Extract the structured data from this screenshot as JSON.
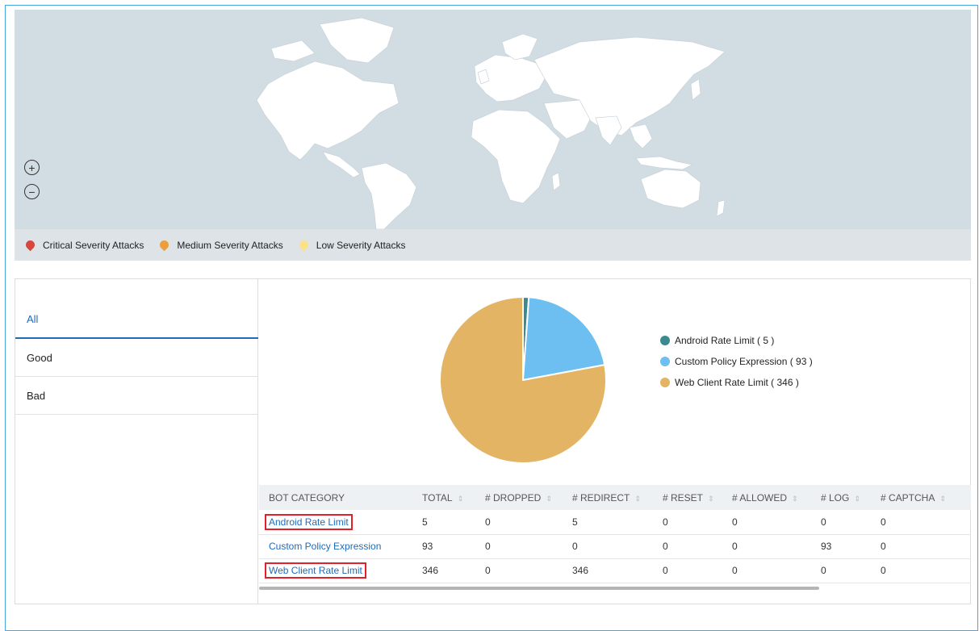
{
  "map": {
    "zoom_in_label": "+",
    "zoom_out_label": "−",
    "legend": [
      {
        "label": "Critical Severity Attacks",
        "color": "#d9463e"
      },
      {
        "label": "Medium Severity Attacks",
        "color": "#ef9d3a"
      },
      {
        "label": "Low Severity Attacks",
        "color": "#fbe28a"
      }
    ]
  },
  "tabs": [
    {
      "label": "All",
      "active": true
    },
    {
      "label": "Good",
      "active": false
    },
    {
      "label": "Bad",
      "active": false
    }
  ],
  "pie": {
    "slices": [
      {
        "label": "Android Rate Limit ( 5 )",
        "value": 5,
        "color": "#3b8a8f"
      },
      {
        "label": "Custom Policy Expression ( 93 )",
        "value": 93,
        "color": "#6cbff0"
      },
      {
        "label": "Web Client Rate Limit ( 346 )",
        "value": 346,
        "color": "#e2b464"
      }
    ]
  },
  "table": {
    "columns": [
      "BOT CATEGORY",
      "TOTAL",
      "# DROPPED",
      "# REDIRECT",
      "# RESET",
      "# ALLOWED",
      "# LOG",
      "# CAPTCHA"
    ],
    "rows": [
      [
        "Android Rate Limit",
        "5",
        "0",
        "5",
        "0",
        "0",
        "0",
        "0"
      ],
      [
        "Custom Policy Expression",
        "93",
        "0",
        "0",
        "0",
        "0",
        "93",
        "0"
      ],
      [
        "Web Client Rate Limit",
        "346",
        "0",
        "346",
        "0",
        "0",
        "0",
        "0"
      ]
    ]
  }
}
